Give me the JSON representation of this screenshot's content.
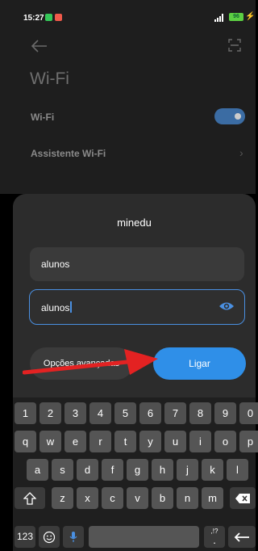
{
  "status": {
    "time": "15:27",
    "battery": "96"
  },
  "settings": {
    "title": "Wi-Fi",
    "wifi_label": "Wi-Fi",
    "assist_label": "Assistente Wi-Fi"
  },
  "dialog": {
    "title": "minedu",
    "username": "alunos",
    "password": "alunos",
    "options_label": "Opções avançadas",
    "connect_label": "Ligar"
  },
  "keyboard": {
    "row1": [
      "1",
      "2",
      "3",
      "4",
      "5",
      "6",
      "7",
      "8",
      "9",
      "0"
    ],
    "row2": [
      "q",
      "w",
      "e",
      "r",
      "t",
      "y",
      "u",
      "i",
      "o",
      "p"
    ],
    "row3": [
      "a",
      "s",
      "d",
      "f",
      "g",
      "h",
      "j",
      "k",
      "l"
    ],
    "row4": [
      "z",
      "x",
      "c",
      "v",
      "b",
      "n",
      "m"
    ],
    "symbols_label": "123",
    "punct_label": ",!?",
    "dot_label": "."
  },
  "colors": {
    "accent": "#2f8fe8",
    "toggle": "#3b6ca3",
    "annotation": "#e32222"
  }
}
